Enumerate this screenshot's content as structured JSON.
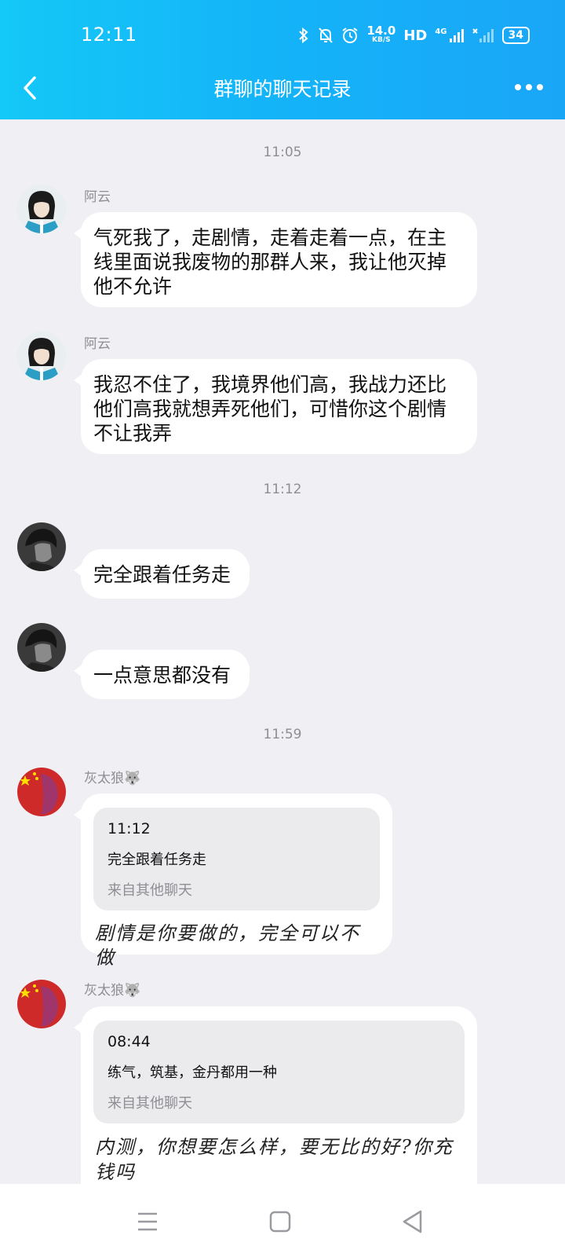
{
  "status": {
    "time": "12:11",
    "net_speed_value": "14.0",
    "net_speed_unit": "KB/S",
    "hd": "HD",
    "signal_tag": "4G",
    "battery": "34",
    "icons": [
      "bluetooth-icon",
      "mute-bell-icon",
      "alarm-icon",
      "signal-icon",
      "battery-icon"
    ]
  },
  "header": {
    "title": "群聊的聊天记录"
  },
  "messages": [
    {
      "type": "time",
      "text": "11:05"
    },
    {
      "type": "msg",
      "sender": "阿云",
      "text": "气死我了，走剧情，走着走着一点，在主线里面说我废物的那群人来，我让他灭掉他不允许"
    },
    {
      "type": "msg",
      "sender": "阿云",
      "text": "我忍不住了，我境界他们高，我战力还比他们高我就想弄死他们，可惜你这个剧情不让我弄"
    },
    {
      "type": "time",
      "text": "11:12"
    },
    {
      "type": "msg",
      "sender": "",
      "text": "完全跟着任务走"
    },
    {
      "type": "msg",
      "sender": "",
      "text": "一点意思都没有"
    },
    {
      "type": "time",
      "text": "11:59"
    },
    {
      "type": "quote",
      "sender": "灰太狼🐺",
      "quote_time": "11:12",
      "quote_text": "完全跟着任务走",
      "quote_source": "来自其他聊天",
      "text": "剧情是你要做的，完全可以不做"
    },
    {
      "type": "quote",
      "sender": "灰太狼🐺",
      "quote_time": "08:44",
      "quote_text": "练气，筑基，金丹都用一种",
      "quote_source": "来自其他聊天",
      "text": "内测，你想要怎么样，要无比的好?你充钱吗"
    }
  ],
  "colors": {
    "header_start": "#14c8f7",
    "header_end": "#1aa6f7",
    "background": "#efeff4",
    "bubble": "#ffffff"
  }
}
